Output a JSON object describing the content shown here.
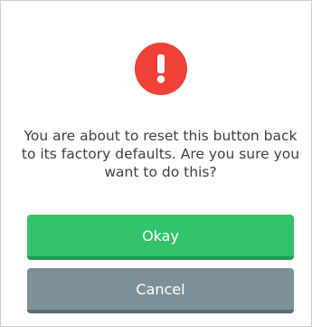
{
  "dialog": {
    "icon": "exclamation-icon",
    "message": "You are about to reset this button back to its factory defaults. Are you sure you want to do this?",
    "okay_label": "Okay",
    "cancel_label": "Cancel"
  },
  "colors": {
    "alert": "#ef4136",
    "okay": "#33c36a",
    "okay_shadow": "#229a50",
    "cancel": "#7d8f99",
    "cancel_shadow": "#5e6d76",
    "text": "#3f3f3f"
  }
}
